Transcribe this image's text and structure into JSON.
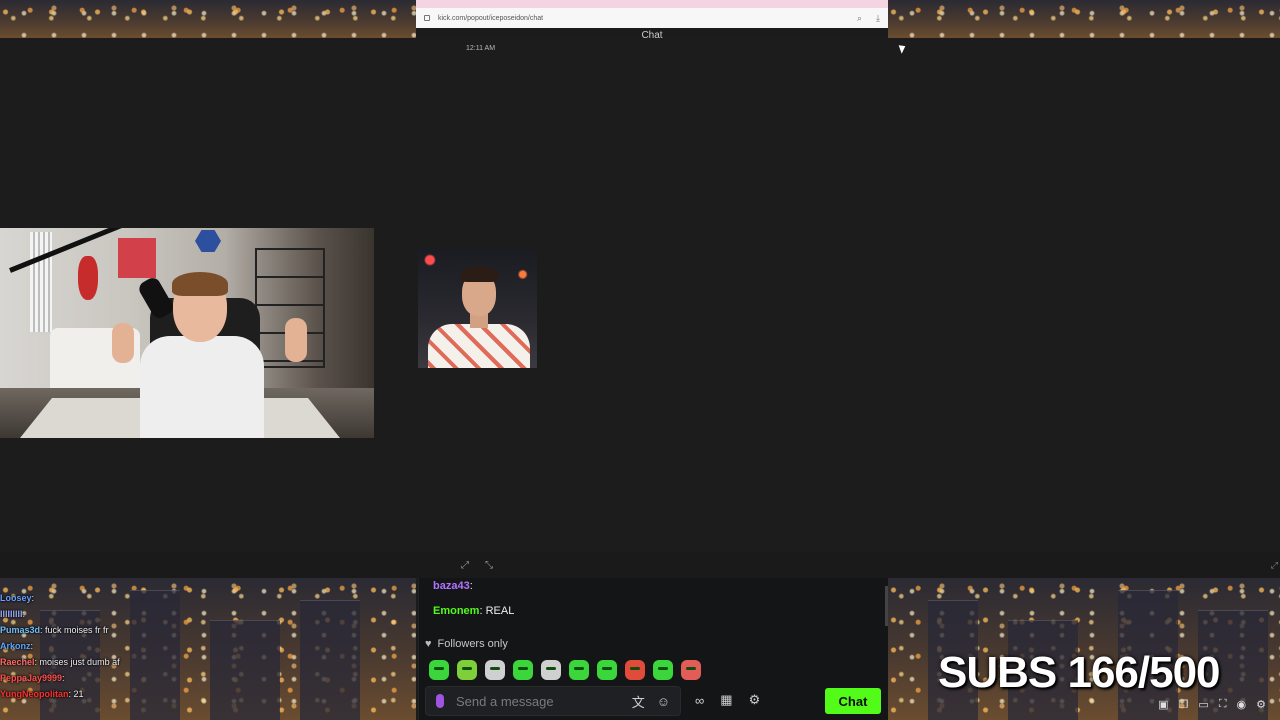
{
  "browser": {
    "url": "kick.com/popout/iceposeidon/chat",
    "chat_header": "Chat"
  },
  "timestamp": "12:11 AM",
  "overlay_chat": [
    {
      "user": "Loosey",
      "text": "",
      "color": "#6aa0ff"
    },
    {
      "user": "lllIlllll",
      "text": "",
      "color": "#9ab0ff"
    },
    {
      "user": "Pumas3d",
      "text": "fuck moises fr fr",
      "color": "#6ec0ff"
    },
    {
      "user": "Arkonz",
      "text": "",
      "color": "#58a6ff"
    },
    {
      "user": "Raechel",
      "text": "moises just dumb af",
      "color": "#ff6b6b"
    },
    {
      "user": "PeppaJay9999",
      "text": "",
      "color": "#ff4f4f"
    },
    {
      "user": "YungNeopolitan",
      "text": "21",
      "color": "#ff3030"
    }
  ],
  "kick_chat": {
    "messages": [
      {
        "user": "baza43",
        "text": "",
        "color": "#b274ff"
      },
      {
        "user": "Emonem",
        "text": "REAL",
        "color": "#53fc18"
      }
    ],
    "followers_only": "Followers only",
    "placeholder": "Send a message",
    "chat_button": "Chat"
  },
  "subs": "SUBS 166/500",
  "colors": {
    "kick_green": "#53fc18",
    "background": "#1c1c1c"
  },
  "icons": [
    "mic-icon",
    "translate-icon",
    "emoji-icon",
    "infinity-icon",
    "store-icon",
    "settings-icon"
  ]
}
